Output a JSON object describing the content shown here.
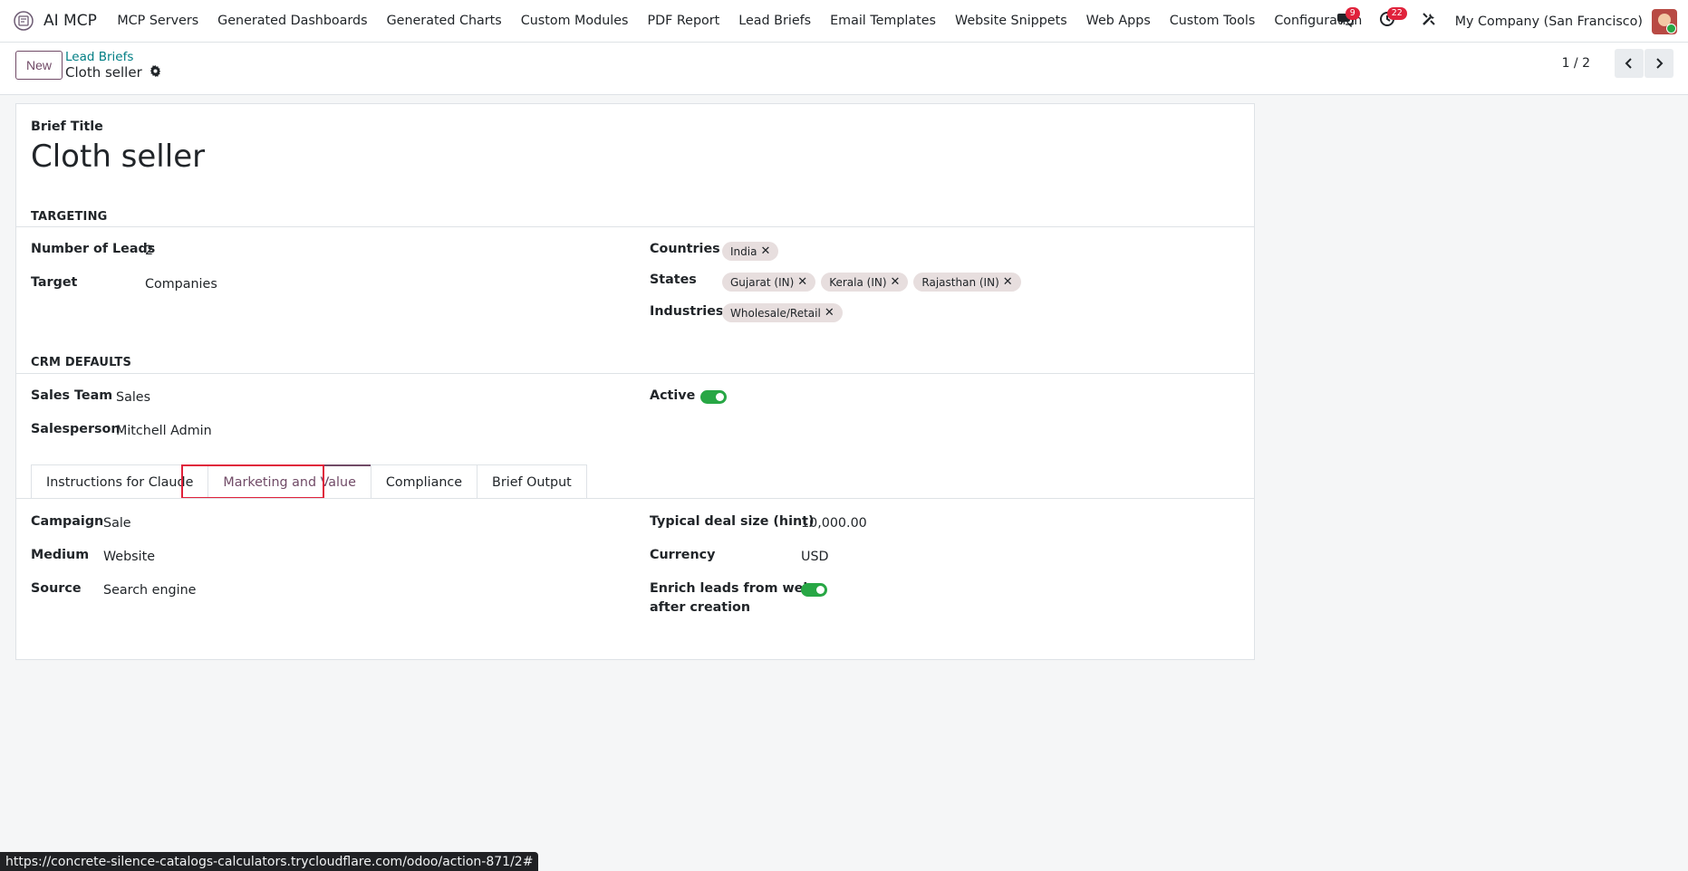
{
  "app": {
    "name": "AI MCP",
    "menu": [
      "MCP Servers",
      "Generated Dashboards",
      "Generated Charts",
      "Custom Modules",
      "PDF Report",
      "Lead Briefs",
      "Email Templates",
      "Website Snippets",
      "Web Apps",
      "Custom Tools",
      "Configuration"
    ]
  },
  "systray": {
    "messages_count": "9",
    "activity_count": "22",
    "company": "My Company (San Francisco)"
  },
  "control": {
    "new_label": "New",
    "breadcrumb_parent": "Lead Briefs",
    "record_name": "Cloth seller",
    "pager": "1 / 2"
  },
  "form": {
    "title_label": "Brief Title",
    "title_value": "Cloth seller",
    "targeting": {
      "section": "TARGETING",
      "leads_label": "Number of Leads",
      "leads_value": "2",
      "target_label": "Target",
      "target_value": "Companies",
      "countries_label": "Countries",
      "countries": [
        "India"
      ],
      "states_label": "States",
      "states": [
        "Gujarat (IN)",
        "Kerala (IN)",
        "Rajasthan (IN)"
      ],
      "industries_label": "Industries",
      "industries": [
        "Wholesale/Retail"
      ]
    },
    "crm": {
      "section": "CRM DEFAULTS",
      "team_label": "Sales Team",
      "team_value": "Sales",
      "salesperson_label": "Salesperson",
      "salesperson_value": "Mitchell Admin",
      "active_label": "Active",
      "active": true
    },
    "tabs": [
      "Instructions for Claude",
      "Marketing and Value",
      "Compliance",
      "Brief Output"
    ],
    "active_tab": "Marketing and Value",
    "marketing": {
      "campaign_label": "Campaign",
      "campaign_value": "Sale",
      "medium_label": "Medium",
      "medium_value": "Website",
      "source_label": "Source",
      "source_value": "Search engine",
      "deal_label": "Typical deal size (hint)",
      "deal_value": "10,000.00",
      "currency_label": "Currency",
      "currency_value": "USD",
      "enrich_label_1": "Enrich leads from web",
      "enrich_label_2": "after creation",
      "enrich": true
    }
  },
  "status_url": "https://concrete-silence-catalogs-calculators.trycloudflare.com/odoo/action-871/2#",
  "colors": {
    "brand": "#714b67",
    "link": "#017e84",
    "toggle_on": "#28a745",
    "badge": "#e0223b",
    "highlight": "#e0223b"
  },
  "icons": [
    "app-icon",
    "chat-icon",
    "clock-icon",
    "tools-icon",
    "gear-icon",
    "chevron-left-icon",
    "chevron-right-icon",
    "close-icon"
  ]
}
